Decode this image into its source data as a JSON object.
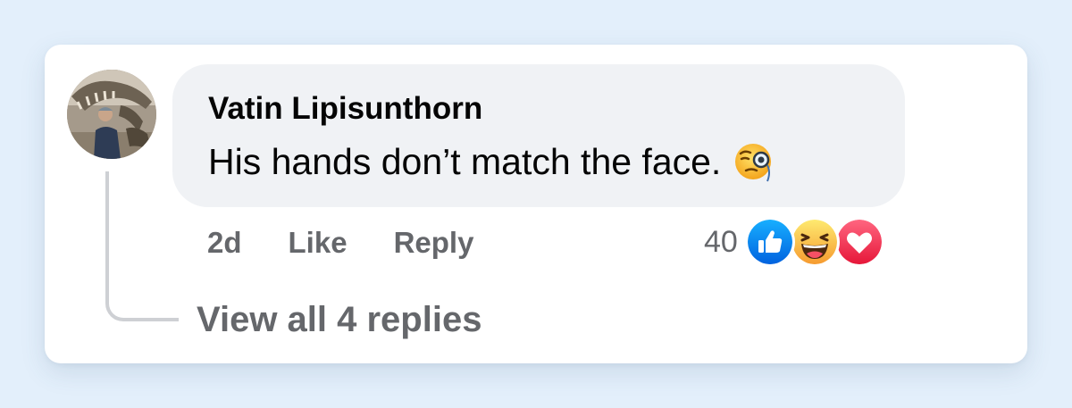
{
  "comment": {
    "author": "Vatin Lipisunthorn",
    "text": "His hands don’t match the face.",
    "text_emoji": "face-with-monocle-icon"
  },
  "actions": {
    "time": "2d",
    "like_label": "Like",
    "reply_label": "Reply"
  },
  "reactions": {
    "count": "40",
    "icons": [
      "like-reaction-icon",
      "haha-reaction-icon",
      "love-reaction-icon"
    ]
  },
  "replies": {
    "view_label": "View all 4 replies"
  },
  "colors": {
    "page_background": "#e3effb",
    "bubble_background": "#f0f2f5",
    "secondary_text": "#65676b",
    "like_blue": "#1877f2",
    "love_red": "#f33e58",
    "haha_yellow": "#f7b125"
  }
}
